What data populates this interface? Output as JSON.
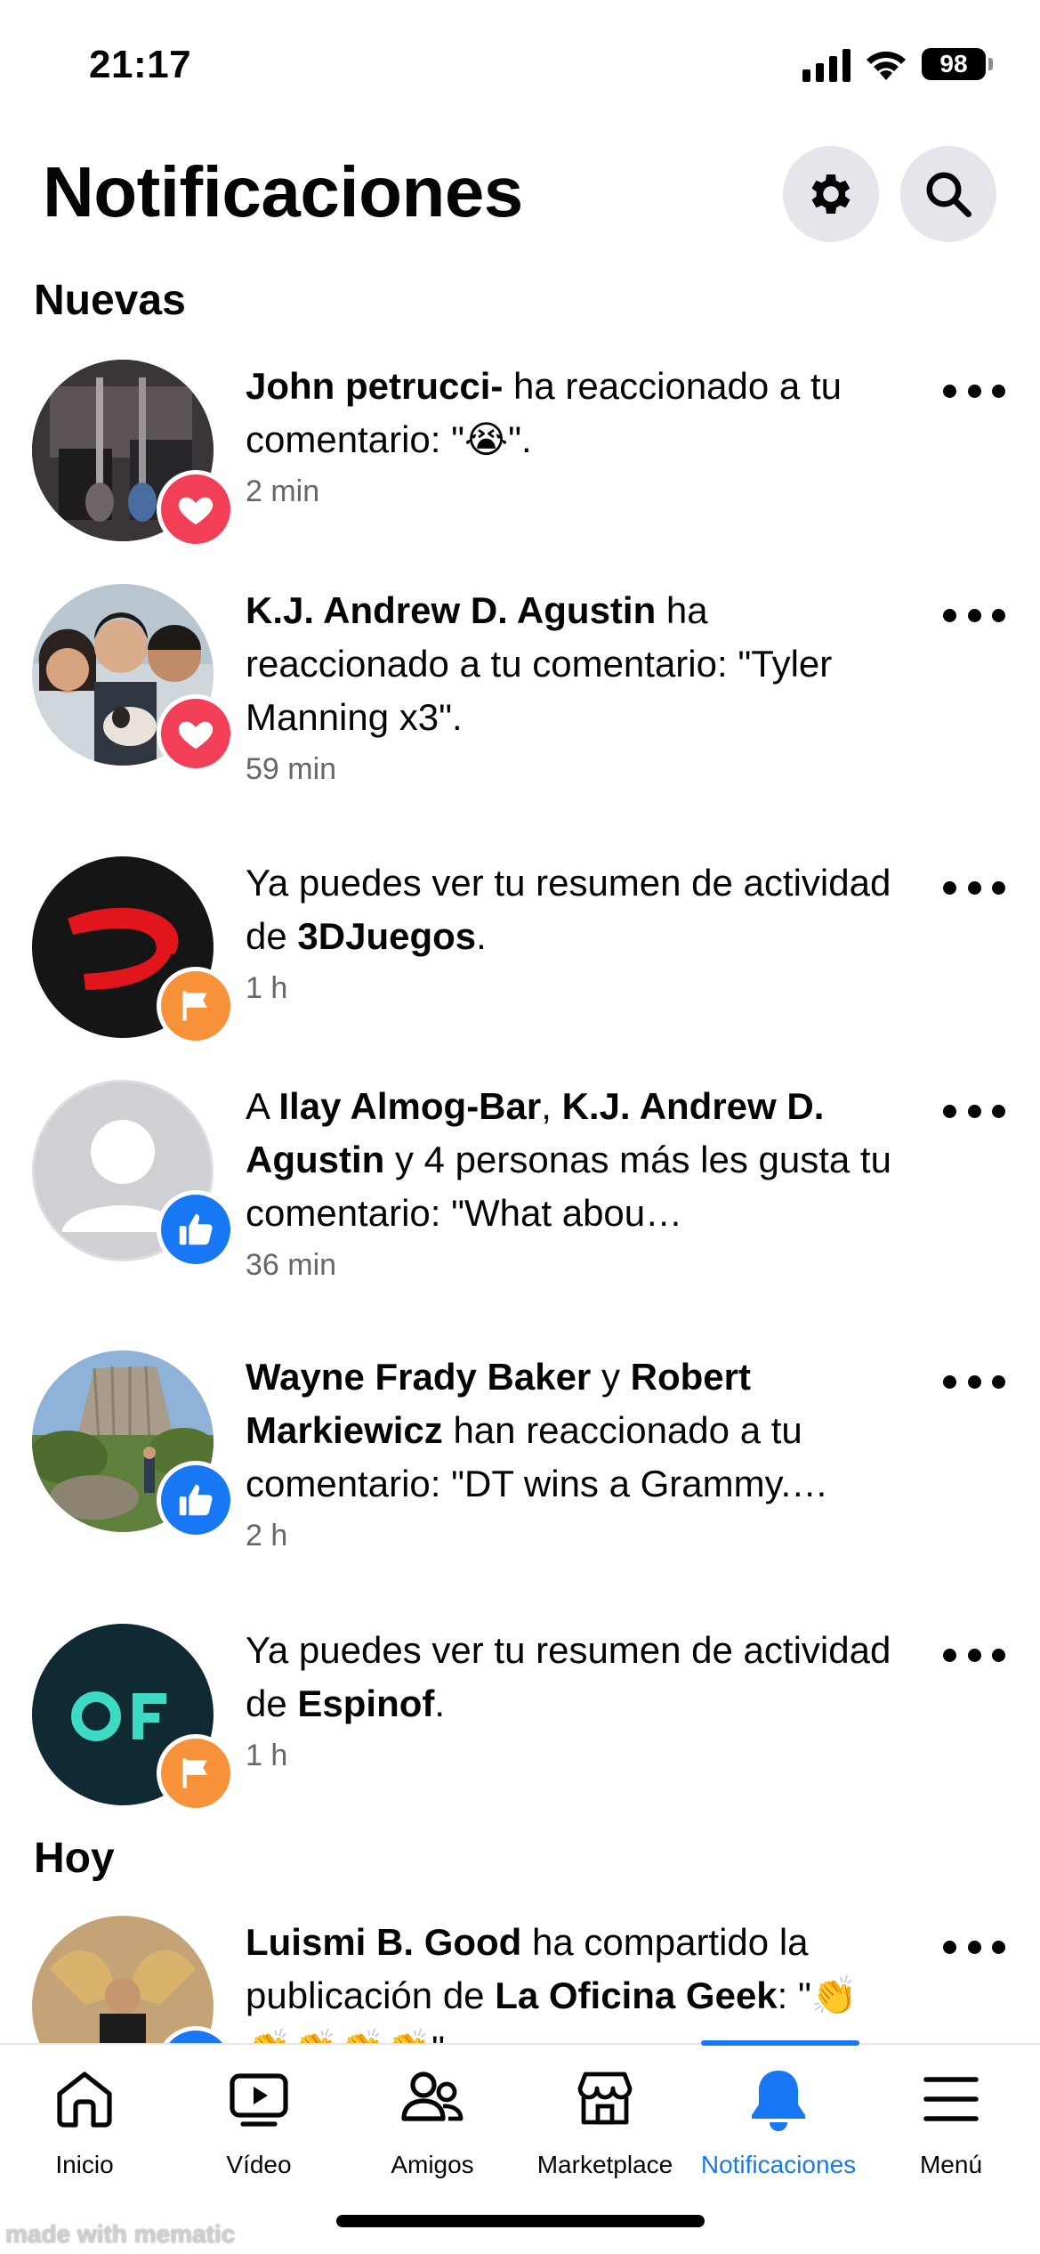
{
  "status_bar": {
    "time": "21:17",
    "battery": "98"
  },
  "header": {
    "title": "Notificaciones",
    "settings_icon": "gear-icon",
    "search_icon": "search-icon"
  },
  "sections": {
    "new": "Nuevas",
    "today": "Hoy"
  },
  "notifications": [
    {
      "parts": [
        {
          "b": true,
          "t": "John petrucci-"
        },
        {
          "b": false,
          "t": " ha reaccionado a tu comentario: \"😭\"."
        }
      ],
      "time": "2 min",
      "badge": "love"
    },
    {
      "parts": [
        {
          "b": true,
          "t": "K.J. Andrew D. Agustin"
        },
        {
          "b": false,
          "t": " ha reaccionado a tu comentario: \"Tyler Manning x3\"."
        }
      ],
      "time": "59 min",
      "badge": "love"
    },
    {
      "parts": [
        {
          "b": false,
          "t": "Ya puedes ver tu resumen de actividad de "
        },
        {
          "b": true,
          "t": "3DJuegos"
        },
        {
          "b": false,
          "t": "."
        }
      ],
      "time": "1 h",
      "badge": "flag"
    },
    {
      "parts": [
        {
          "b": false,
          "t": "A "
        },
        {
          "b": true,
          "t": "Ilay Almog-Bar"
        },
        {
          "b": false,
          "t": ", "
        },
        {
          "b": true,
          "t": "K.J. Andrew D. Agustin"
        },
        {
          "b": false,
          "t": " y 4 personas más les gusta tu comentario: \"What abou…"
        }
      ],
      "time": "36 min",
      "badge": "like"
    },
    {
      "parts": [
        {
          "b": true,
          "t": "Wayne Frady Baker"
        },
        {
          "b": false,
          "t": " y "
        },
        {
          "b": true,
          "t": "Robert Markiewicz"
        },
        {
          "b": false,
          "t": " han reaccionado a tu comentario: \"DT wins a Grammy.…"
        }
      ],
      "time": "2 h",
      "badge": "like"
    },
    {
      "parts": [
        {
          "b": false,
          "t": "Ya puedes ver tu resumen de actividad de "
        },
        {
          "b": true,
          "t": "Espinof"
        },
        {
          "b": false,
          "t": "."
        }
      ],
      "time": "1 h",
      "badge": "flag"
    },
    {
      "parts": [
        {
          "b": true,
          "t": "Luismi B. Good"
        },
        {
          "b": false,
          "t": " ha compartido la publicación de "
        },
        {
          "b": true,
          "t": "La Oficina Geek"
        },
        {
          "b": false,
          "t": ": \"👏👏👏👏👏\""
        }
      ],
      "time": "",
      "badge": "like"
    }
  ],
  "tabs": [
    {
      "label": "Inicio",
      "icon": "home-icon"
    },
    {
      "label": "Vídeo",
      "icon": "video-icon"
    },
    {
      "label": "Amigos",
      "icon": "friends-icon"
    },
    {
      "label": "Marketplace",
      "icon": "marketplace-icon"
    },
    {
      "label": "Notificaciones",
      "icon": "bell-icon",
      "active": true
    },
    {
      "label": "Menú",
      "icon": "menu-icon"
    }
  ],
  "colors": {
    "accent": "#1877f2",
    "love": "#f33e58",
    "flag": "#f7923b",
    "secondary_text": "#65676b"
  },
  "watermark": "made with mematic"
}
